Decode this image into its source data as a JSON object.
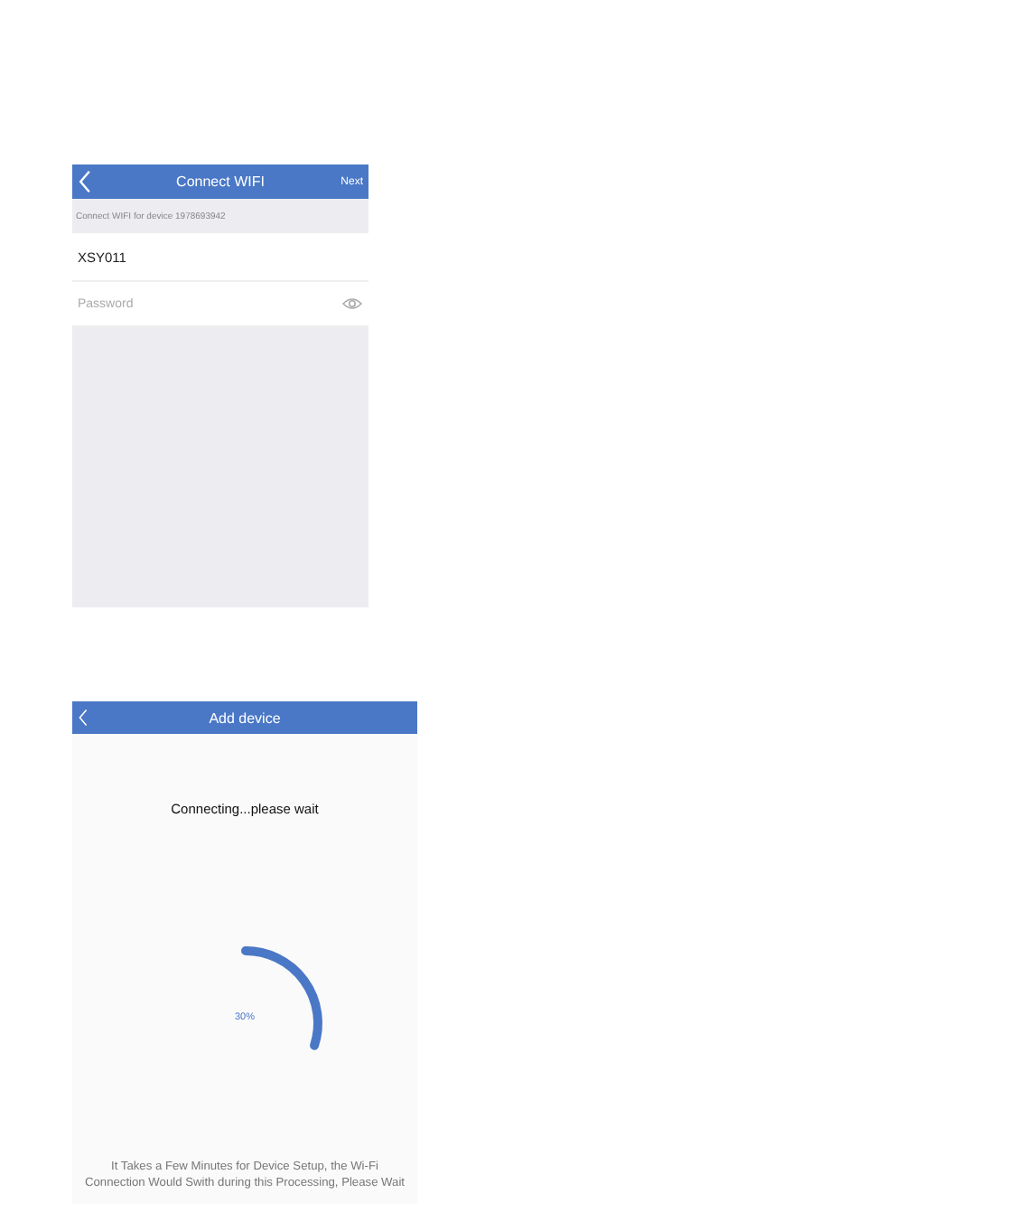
{
  "connect_screen": {
    "title": "Connect WIFI",
    "next_button": "Next",
    "subtitle": "Connect WIFI for device 1978693942",
    "ssid": "XSY011",
    "password": {
      "placeholder": "Password"
    }
  },
  "add_device_screen": {
    "title": "Add device",
    "status": "Connecting...please wait",
    "progress": {
      "reading": "30%"
    },
    "note": "It Takes a Few Minutes for Device Setup, the Wi-Fi Connection Would Swith during this Processing, Please Wait"
  }
}
